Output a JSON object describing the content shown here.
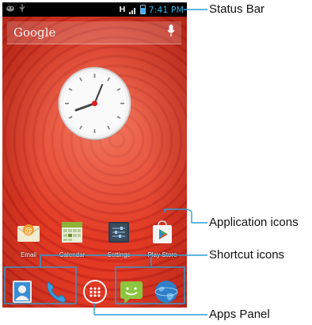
{
  "status_bar": {
    "network": "H",
    "time": "7:41 PM"
  },
  "search": {
    "label": "Google"
  },
  "apps": [
    {
      "label": "Email",
      "icon": "email-icon"
    },
    {
      "label": "Calendar",
      "icon": "calendar-icon"
    },
    {
      "label": "Settings",
      "icon": "settings-icon"
    },
    {
      "label": "Play Store",
      "icon": "play-store-icon"
    }
  ],
  "dock": {
    "items": [
      "contacts-icon",
      "phone-icon",
      "apps-panel-icon",
      "messaging-icon",
      "browser-icon"
    ]
  },
  "callouts": {
    "status_bar": "Status Bar",
    "application_icons": "Application icons",
    "shortcut_icons": "Shortcut icons",
    "apps_panel": "Apps Panel"
  },
  "colors": {
    "wallpaper": "#dd3320",
    "status_time": "#33b5e5",
    "callout_line": "#2a9fd6",
    "dock_frame": "#4aa3df"
  }
}
